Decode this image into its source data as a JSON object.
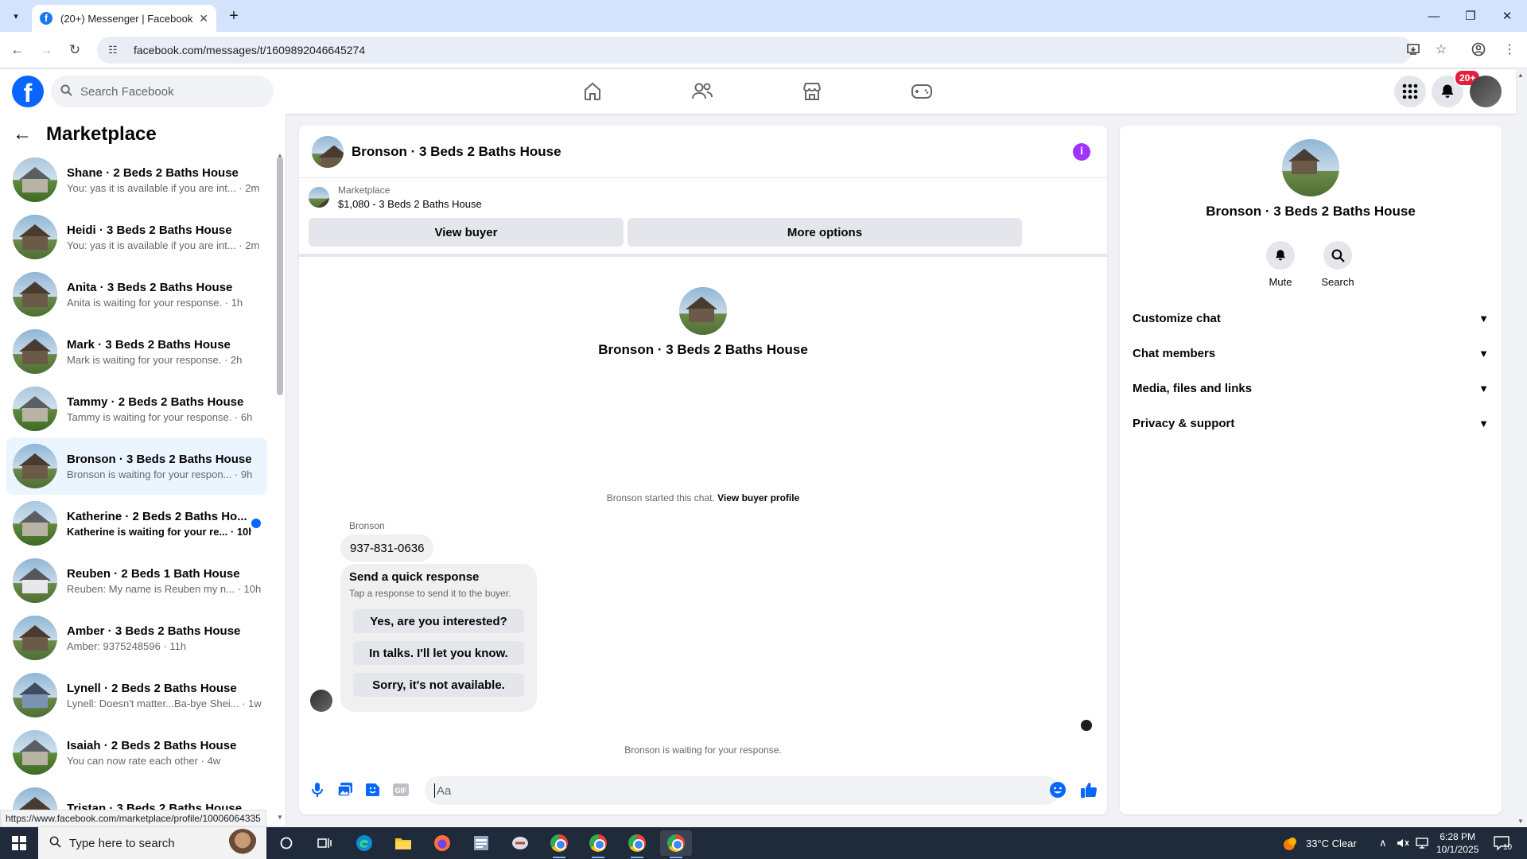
{
  "browser": {
    "tab_title": "(20+) Messenger | Facebook",
    "url": "facebook.com/messages/t/1609892046645274",
    "status_url": "https://www.facebook.com/marketplace/profile/10006064335"
  },
  "fb_header": {
    "logo": "f",
    "search_placeholder": "Search Facebook",
    "notification_badge": "20+"
  },
  "sidebar": {
    "title": "Marketplace",
    "conversations": [
      {
        "name": "Shane · 2 Beds 2 Baths House",
        "preview": "You: yas it is available if you are int... · 2m",
        "style": "green"
      },
      {
        "name": "Heidi · 3 Beds 2 Baths House",
        "preview": "You: yas it is available if you are int... · 2m",
        "style": "brown"
      },
      {
        "name": "Anita · 3 Beds 2 Baths House",
        "preview": "Anita is waiting for your response. · 1h",
        "style": "brown"
      },
      {
        "name": "Mark · 3 Beds 2 Baths House",
        "preview": "Mark is waiting for your response. · 2h",
        "style": "brown"
      },
      {
        "name": "Tammy · 2 Beds 2 Baths House",
        "preview": "Tammy is waiting for your response. · 6h",
        "style": "green"
      },
      {
        "name": "Bronson · 3 Beds 2 Baths House",
        "preview": "Bronson is waiting for your respon... · 9h",
        "style": "brown",
        "active": true
      },
      {
        "name": "Katherine · 2 Beds 2 Baths Ho...",
        "preview": "Katherine is waiting for your re... · 10h",
        "style": "green",
        "unread": true
      },
      {
        "name": "Reuben · 2 Beds 1 Bath House",
        "preview": "Reuben: My name is Reuben my n... · 10h",
        "style": "white"
      },
      {
        "name": "Amber · 3 Beds 2 Baths House",
        "preview": "Amber: 9375248596 · 11h",
        "style": "brown"
      },
      {
        "name": "Lynell · 2 Beds 2 Baths House",
        "preview": "Lynell: Doesn't matter...Ba-bye Shei... · 1w",
        "style": "blue"
      },
      {
        "name": "Isaiah · 2 Beds 2 Baths House",
        "preview": "You can now rate each other · 4w",
        "style": "green"
      },
      {
        "name": "Tristan · 3 Beds 2 Baths House",
        "preview": "",
        "style": "brown"
      }
    ]
  },
  "chat": {
    "title": "Bronson · 3 Beds 2 Baths House",
    "marketplace_label": "Marketplace",
    "listing": "$1,080 - 3 Beds 2 Baths House",
    "view_buyer": "View buyer",
    "more_options": "More options",
    "center_name": "Bronson · 3 Beds 2 Baths House",
    "started_text": "Bronson started this chat.",
    "view_buyer_profile": "View buyer profile",
    "sender": "Bronson",
    "phone_message": "937-831-0636",
    "quick_response_title": "Send a quick response",
    "quick_response_sub": "Tap a response to send it to the buyer.",
    "quick_responses": [
      "Yes, are you interested?",
      "In talks. I'll let you know.",
      "Sorry, it's not available."
    ],
    "waiting_text": "Bronson is waiting for your response.",
    "composer_placeholder": "Aa"
  },
  "info_panel": {
    "name": "Bronson · 3 Beds 2 Baths House",
    "actions": [
      {
        "label": "Mute",
        "icon": "bell-icon"
      },
      {
        "label": "Search",
        "icon": "search-icon"
      }
    ],
    "sections": [
      "Customize chat",
      "Chat members",
      "Media, files and links",
      "Privacy & support"
    ]
  },
  "taskbar": {
    "search_placeholder": "Type here to search",
    "weather": "33°C  Clear",
    "time": "6:28 PM",
    "date": "10/1/2025",
    "notifications": "10"
  },
  "colors": {
    "facebook_blue": "#0866ff",
    "info_purple": "#a033ff",
    "badge_red": "#e41e3f",
    "active_row": "#ebf5ff"
  }
}
